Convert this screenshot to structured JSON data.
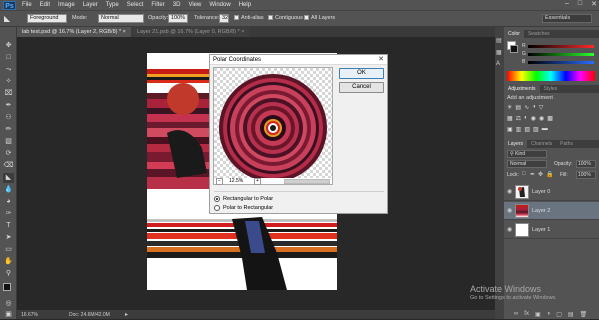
{
  "app": {
    "logo": "Ps"
  },
  "menu": [
    "File",
    "Edit",
    "Image",
    "Layer",
    "Type",
    "Select",
    "Filter",
    "3D",
    "View",
    "Window",
    "Help"
  ],
  "window_controls": {
    "minimize": "–",
    "maximize": "□",
    "close": "✕"
  },
  "options": {
    "tool_value": "Foreground",
    "mode_label": "Mode:",
    "mode_value": "Normal",
    "opacity_label": "Opacity:",
    "opacity_value": "100%",
    "tolerance_label": "Tolerance:",
    "tolerance_value": "32",
    "antialias_label": "Anti-alias",
    "contiguous_label": "Contiguous",
    "all_layers_label": "All Layers",
    "workspace": "Essentials"
  },
  "tabs": [
    {
      "label": "lab test.psd @ 16.7% (Layer 2, RGB/8) *",
      "close": "×"
    },
    {
      "label": "Layer 21.psb @ 16.7% (Layer 0, RGB/8) *",
      "close": "×"
    }
  ],
  "dialog": {
    "title": "Polar Coordinates",
    "close": "✕",
    "ok_label": "OK",
    "cancel_label": "Cancel",
    "zoom_value": "12.5%",
    "zoom_minus": "−",
    "zoom_plus": "+",
    "options": [
      {
        "label": "Rectangular to Polar",
        "selected": true
      },
      {
        "label": "Polar to Rectangular",
        "selected": false
      }
    ]
  },
  "status": {
    "zoom": "16.67%",
    "doc": "Doc: 24.6M/42.0M"
  },
  "color_panel": {
    "tabs": [
      "Color",
      "Swatches"
    ],
    "channels": [
      {
        "label": "R",
        "value": "",
        "color": "#ff2a2a"
      },
      {
        "label": "G",
        "value": "",
        "color": "#2aff2a"
      },
      {
        "label": "B",
        "value": "",
        "color": "#2a6bff"
      }
    ]
  },
  "adjustments_panel": {
    "tabs": [
      "Adjustments",
      "Styles"
    ],
    "heading": "Add an adjustment"
  },
  "layers_panel": {
    "tabs": [
      "Layers",
      "Channels",
      "Paths"
    ],
    "kind_label": "Kind",
    "blend_mode": "Normal",
    "opacity_label": "Opacity:",
    "opacity_value": "100%",
    "lock_label": "Lock:",
    "fill_label": "Fill:",
    "fill_value": "100%",
    "layers": [
      {
        "name": "Layer 0",
        "selected": false
      },
      {
        "name": "Layer 2",
        "selected": true
      },
      {
        "name": "Layer 1",
        "selected": false
      }
    ]
  },
  "watermark": {
    "title": "Activate Windows",
    "subtitle": "Go to Settings to activate Windows."
  },
  "colors": {
    "accent": "#3c7fb1",
    "selected_layer": "#6a7380"
  }
}
